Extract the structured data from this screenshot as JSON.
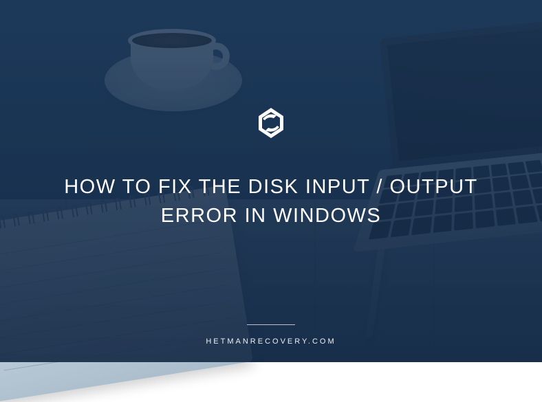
{
  "header": {
    "logo_name": "hetman-logo"
  },
  "main": {
    "title": "HOW TO FIX THE DISK INPUT / OUTPUT ERROR IN WINDOWS"
  },
  "footer": {
    "site": "HETMANRECOVERY.COM"
  }
}
